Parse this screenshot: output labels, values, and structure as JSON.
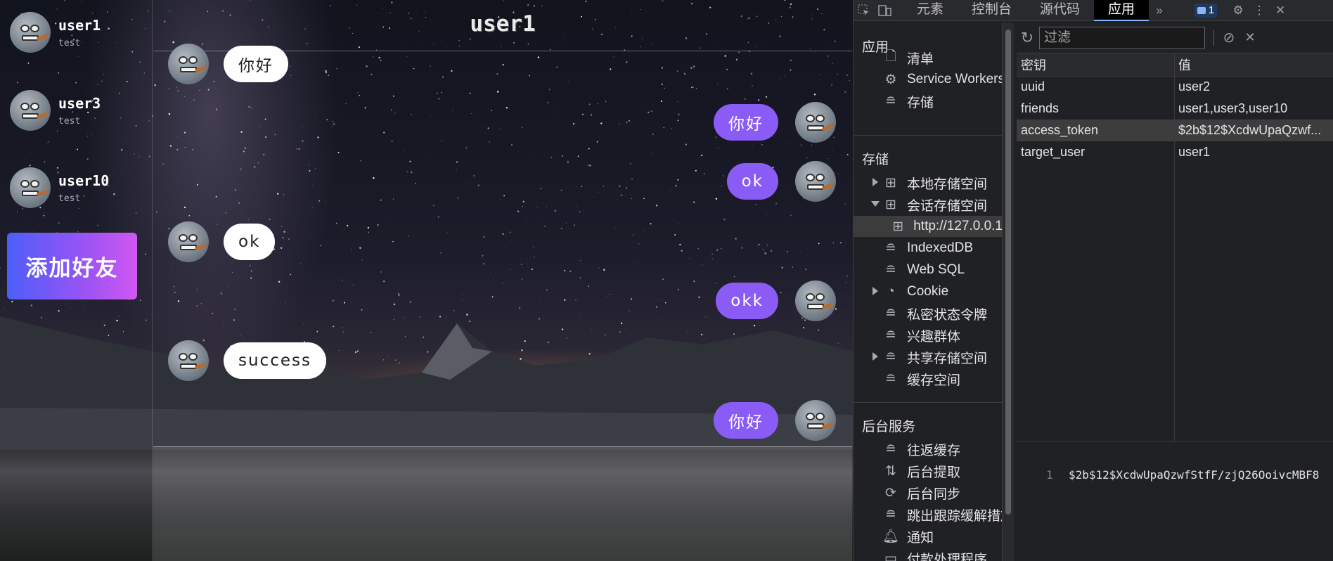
{
  "chat": {
    "title": "user1",
    "friends": [
      {
        "name": "user1",
        "status": "test"
      },
      {
        "name": "user3",
        "status": "test"
      },
      {
        "name": "user10",
        "status": "test"
      }
    ],
    "add_friend_label": "添加好友",
    "messages": [
      {
        "side": "left",
        "text": "你好"
      },
      {
        "side": "right",
        "text": "你好"
      },
      {
        "side": "right",
        "text": "ok"
      },
      {
        "side": "left",
        "text": "ok"
      },
      {
        "side": "right",
        "text": "okk"
      },
      {
        "side": "left",
        "text": "success"
      },
      {
        "side": "right",
        "text": "你好"
      }
    ]
  },
  "devtools": {
    "tabs": [
      "元素",
      "控制台",
      "源代码",
      "应用"
    ],
    "active_tab": "应用",
    "issue_count": "1",
    "sections": {
      "app": "应用",
      "storage": "存储",
      "background": "后台服务"
    },
    "app_items": [
      "清单",
      "Service Workers",
      "存储"
    ],
    "storage_items": [
      "本地存储空间",
      "会话存储空间",
      "http://127.0.0.1",
      "IndexedDB",
      "Web SQL",
      "Cookie",
      "私密状态令牌",
      "兴趣群体",
      "共享存储空间",
      "缓存空间"
    ],
    "background_items": [
      "往返缓存",
      "后台提取",
      "后台同步",
      "跳出跟踪缓解措施",
      "通知",
      "付款处理程序"
    ],
    "filter_placeholder": "过滤",
    "table_headers": {
      "key": "密钥",
      "value": "值"
    },
    "rows": [
      {
        "key": "uuid",
        "value": "user2"
      },
      {
        "key": "friends",
        "value": "user1,user3,user10"
      },
      {
        "key": "access_token",
        "value": "$2b$12$XcdwUpaQzwf..."
      },
      {
        "key": "target_user",
        "value": "user1"
      }
    ],
    "preview_line": "1",
    "preview_value": "$2b$12$XcdwUpaQzwfStfF/zjQ26OoivcMBF8"
  }
}
